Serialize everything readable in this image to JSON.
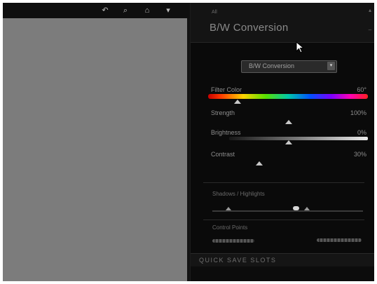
{
  "toolbar": {
    "tools": [
      {
        "name": "undo-icon",
        "glyph": "↶"
      },
      {
        "name": "search-icon",
        "glyph": "⌕"
      },
      {
        "name": "home-icon",
        "glyph": "⌂"
      },
      {
        "name": "chevron-down-icon",
        "glyph": "▾"
      }
    ]
  },
  "panel": {
    "kicker": "All",
    "title": "B/W Conversion",
    "conversion_method": "B/W Conversion",
    "filter_color": {
      "label": "Filter Color",
      "value": "60°"
    },
    "strength": {
      "label": "Strength",
      "value": "100%"
    },
    "brightness": {
      "label": "Brightness",
      "value": "0%"
    },
    "contrast": {
      "label": "Contrast",
      "value": "30%"
    },
    "shadows_highlights": {
      "label": "Shadows / Highlights"
    },
    "control_points": {
      "label": "Control Points"
    },
    "quick_save": "QUICK SAVE SLOTS"
  },
  "colors": {
    "preview_gray": "#7c7c7c",
    "panel_bg": "#0a0a0a",
    "text_gray": "#8e8e8e"
  }
}
